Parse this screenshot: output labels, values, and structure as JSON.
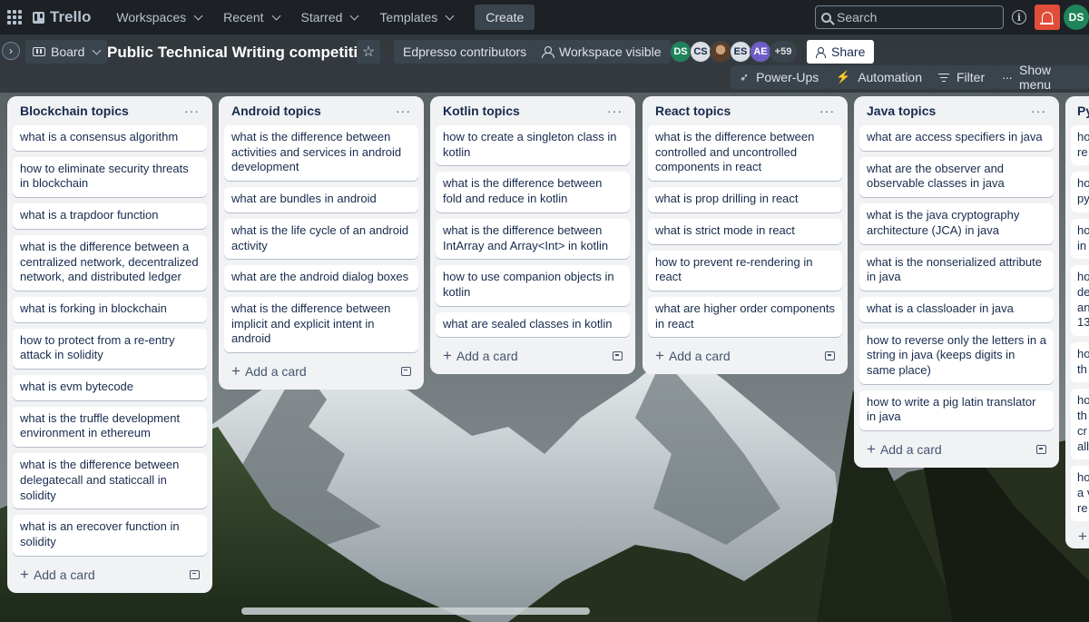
{
  "topbar": {
    "logo": "Trello",
    "nav": [
      {
        "label": "Workspaces"
      },
      {
        "label": "Recent"
      },
      {
        "label": "Starred"
      },
      {
        "label": "Templates"
      }
    ],
    "create_label": "Create",
    "search_placeholder": "Search",
    "user_initials": "DS"
  },
  "board": {
    "view_label": "Board",
    "title": "Public Technical Writing competition",
    "workspace_label": "Edpresso contributors",
    "visibility_label": "Workspace visible",
    "members": [
      {
        "initials": "DS",
        "color": "#1f845a",
        "text": "#ffffff"
      },
      {
        "initials": "CS",
        "color": "#dcdfe4",
        "text": "#172b4d"
      },
      {
        "initials": "",
        "color": "#8a6a4d",
        "text": "#ffffff"
      },
      {
        "initials": "ES",
        "color": "#dcdfe4",
        "text": "#172b4d"
      },
      {
        "initials": "AE",
        "color": "#6e5dc6",
        "text": "#ffffff"
      },
      {
        "initials": "+59",
        "color": "#3a444c",
        "text": "#dfe1e6"
      }
    ],
    "share_label": "Share",
    "powerups_label": "Power-Ups",
    "automation_label": "Automation",
    "filter_label": "Filter",
    "show_menu_label": "Show menu"
  },
  "add_card_label": "Add a card",
  "lists": [
    {
      "title": "Blockchain topics",
      "cards": [
        "what is a consensus algorithm",
        "how to eliminate security threats in blockchain",
        "what is a trapdoor function",
        "what is the difference between a centralized network, decentralized network, and distributed ledger",
        "what is forking in blockchain",
        "how to protect from a re-entry attack in solidity",
        "what is evm bytecode",
        "what is the truffle development environment in ethereum",
        "what is the difference between delegatecall and staticcall in solidity",
        "what is an erecover function in solidity"
      ]
    },
    {
      "title": "Android topics",
      "cards": [
        "what is the difference between activities and services in android development",
        "what are bundles in android",
        "what is the life cycle of an android activity",
        "what are the android dialog boxes",
        "what is the difference between implicit and explicit intent in android"
      ]
    },
    {
      "title": "Kotlin topics",
      "cards": [
        "how to create a singleton class in kotlin",
        "what is the difference between fold and reduce in kotlin",
        "what is the difference between IntArray and Array<Int> in kotlin",
        "how to use companion objects in kotlin",
        "what are sealed classes in kotlin"
      ]
    },
    {
      "title": "React topics",
      "cards": [
        "what is the difference between controlled and uncontrolled components in react",
        "what is prop drilling in react",
        "what is strict mode in react",
        "how to prevent re-rendering in react",
        "what are higher order components in react"
      ]
    },
    {
      "title": "Java topics",
      "cards": [
        "what are access specifiers in java",
        "what are the observer and observable classes in java",
        "what is the java cryptography architecture (JCA) in java",
        "what is the nonserialized attribute in java",
        "what is a classloader in java",
        "how to reverse only the letters in a string in java (keeps digits in same place)",
        "how to write a pig latin translator in java"
      ]
    }
  ],
  "partial_list": {
    "title": "Py",
    "cards": [
      [
        "ho",
        "re"
      ],
      [
        "ho",
        "py"
      ],
      [
        "ho",
        "in"
      ],
      [
        "ho",
        "de",
        "an",
        "13"
      ],
      [
        "ho",
        "th"
      ],
      [
        "ho",
        "th",
        "cr",
        "all"
      ],
      [
        "ho",
        "a v",
        "re"
      ]
    ]
  }
}
